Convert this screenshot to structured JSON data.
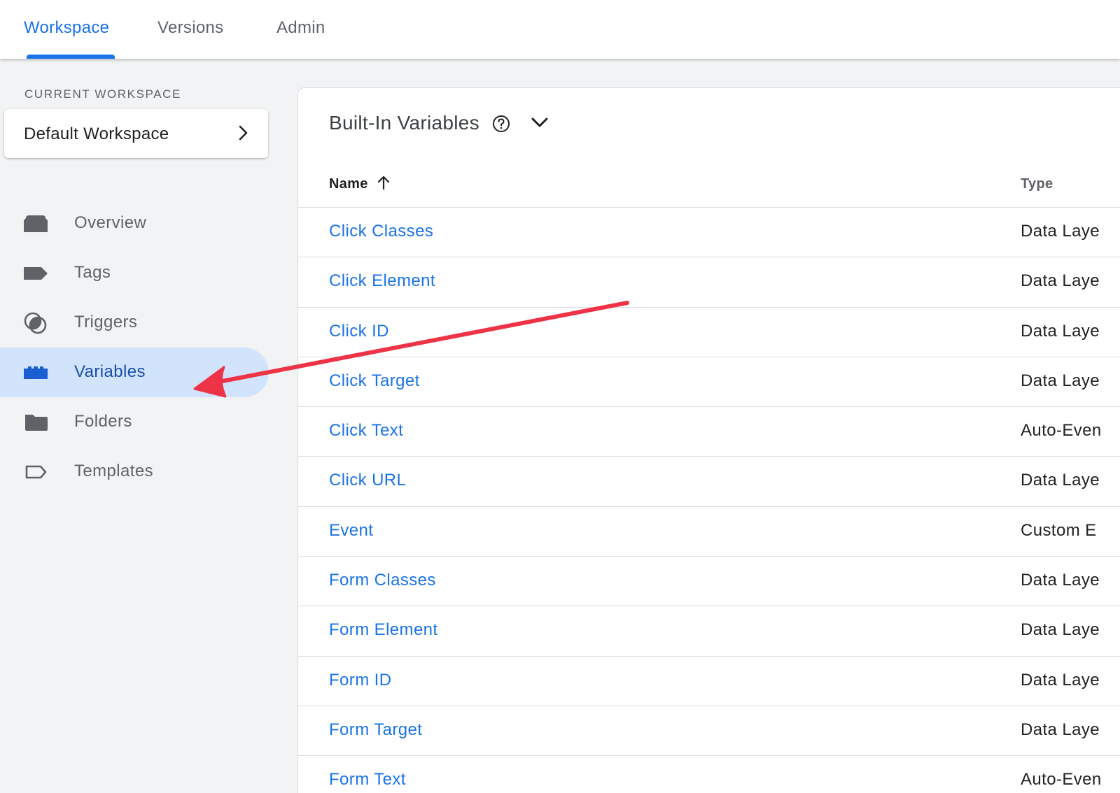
{
  "topnav": {
    "tabs": [
      {
        "label": "Workspace",
        "active": true
      },
      {
        "label": "Versions",
        "active": false
      },
      {
        "label": "Admin",
        "active": false
      }
    ]
  },
  "sidebar": {
    "section_label": "CURRENT WORKSPACE",
    "workspace_name": "Default Workspace",
    "items": [
      {
        "label": "Overview",
        "icon": "overview-icon"
      },
      {
        "label": "Tags",
        "icon": "tag-icon"
      },
      {
        "label": "Triggers",
        "icon": "trigger-icon"
      },
      {
        "label": "Variables",
        "icon": "variables-icon",
        "active": true
      },
      {
        "label": "Folders",
        "icon": "folder-icon"
      },
      {
        "label": "Templates",
        "icon": "template-icon"
      }
    ]
  },
  "main": {
    "title": "Built-In Variables",
    "columns": {
      "name": "Name",
      "type": "Type"
    },
    "rows": [
      {
        "name": "Click Classes",
        "type": "Data Laye"
      },
      {
        "name": "Click Element",
        "type": "Data Laye"
      },
      {
        "name": "Click ID",
        "type": "Data Laye"
      },
      {
        "name": "Click Target",
        "type": "Data Laye"
      },
      {
        "name": "Click Text",
        "type": "Auto-Even"
      },
      {
        "name": "Click URL",
        "type": "Data Laye"
      },
      {
        "name": "Event",
        "type": "Custom E"
      },
      {
        "name": "Form Classes",
        "type": "Data Laye"
      },
      {
        "name": "Form Element",
        "type": "Data Laye"
      },
      {
        "name": "Form ID",
        "type": "Data Laye"
      },
      {
        "name": "Form Target",
        "type": "Data Laye"
      },
      {
        "name": "Form Text",
        "type": "Auto-Even"
      }
    ]
  },
  "colors": {
    "accent": "#1a73e8",
    "active_nav_bg": "#d2e3fc",
    "annotation_arrow": "#ee3347"
  }
}
